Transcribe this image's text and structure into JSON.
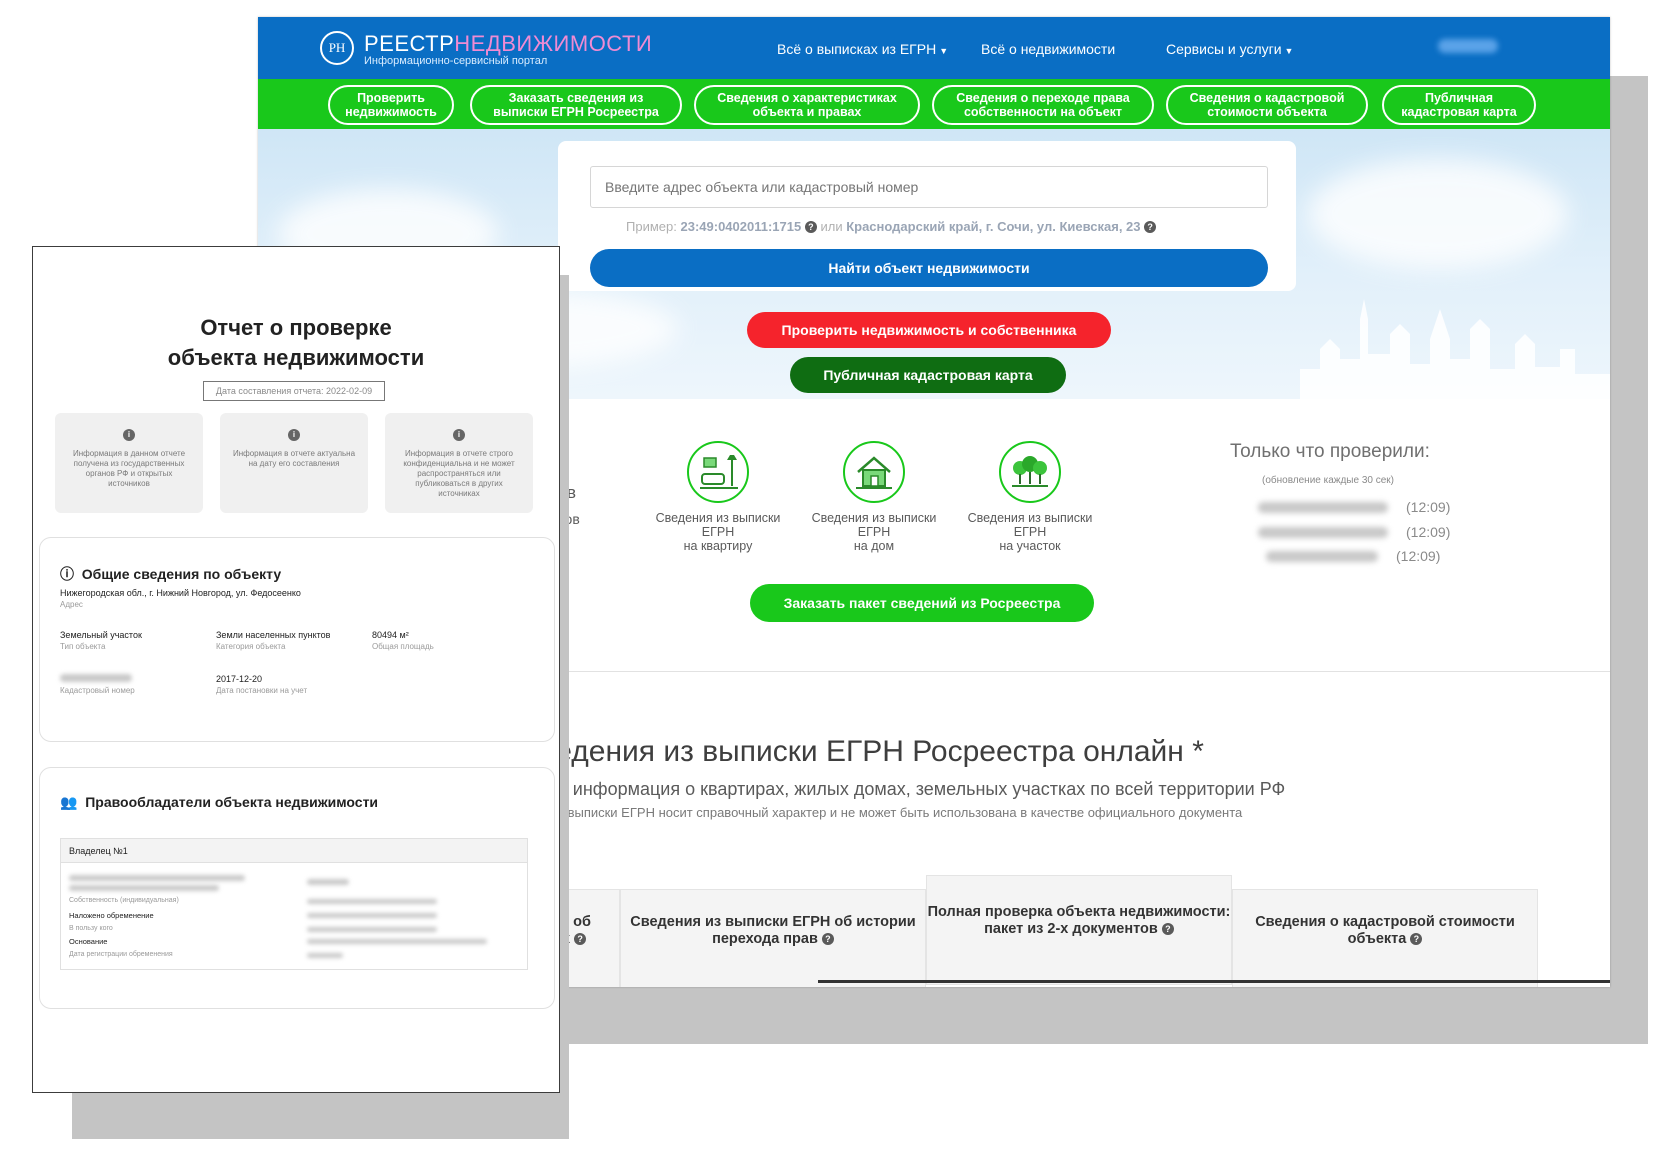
{
  "site": {
    "logo_mark": "РН",
    "logo_title_part1": "РЕЕСТР",
    "logo_title_part2": "НЕДВИЖИМОСТИ",
    "logo_subtitle": "Информационно-сервисный портал",
    "nav": [
      {
        "label": "Всё о выписках из ЕГРН",
        "dropdown": true
      },
      {
        "label": "Всё о недвижимости",
        "dropdown": false
      },
      {
        "label": "Сервисы и услуги",
        "dropdown": true
      }
    ],
    "green_nav": [
      "Проверить недвижимость",
      "Заказать сведения из выписки ЕГРН Росреестра",
      "Сведения о характеристиках объекта и правах",
      "Сведения о переходе права собственности на объект",
      "Сведения о кадастровой стоимости объекта",
      "Публичная кадастровая карта"
    ],
    "search": {
      "placeholder": "Введите адрес объекта или кадастровый номер",
      "example_prefix": "Пример:",
      "example_number": "23:49:0402011:1715",
      "example_or": "или",
      "example_address": "Краснодарский край, г. Сочи, ул. Киевская, 23"
    },
    "buttons": {
      "find": "Найти объект недвижимости",
      "check": "Проверить недвижимость и собственника",
      "map": "Публичная кадастровая карта",
      "order": "Заказать пакет сведений из Росреестра"
    },
    "services": [
      {
        "line1": "Сведения из выписки",
        "line2": "ЕГРН",
        "line3": "на квартиру",
        "icon": "apartment-icon"
      },
      {
        "line1": "Сведения из выписки",
        "line2": "ЕГРН",
        "line3": "на дом",
        "icon": "house-icon"
      },
      {
        "line1": "Сведения из выписки",
        "line2": "ЕГРН",
        "line3": "на участок",
        "icon": "land-plot-icon"
      }
    ],
    "partial_left": [
      "росов",
      "заказов"
    ],
    "recent": {
      "title": "Только что проверили:",
      "note": "(обновление каждые 30 сек)",
      "times": [
        "(12:09)",
        "(12:09)",
        "(12:09)"
      ]
    },
    "section": {
      "title": "Сведения из выписки ЕГРН Росреестра онлайн *",
      "subtitle": "ая информация о квартирах, жилых домах, земельных участках по всей территории РФ",
      "note": "з выписки ЕГРН носит справочный характер и не может быть использована в качестве официального документа"
    },
    "columns": {
      "partial_line1": "РН об",
      "partial_line2": "ах",
      "col2": "Сведения из выписки ЕГРН об истории перехода прав",
      "col3": "Полная проверка объекта недвижимости: пакет из 2-х документов",
      "col4": "Сведения о кадастровой стоимости объекта"
    },
    "colors": {
      "blue": "#0a6ec4",
      "green": "#19c81b",
      "red": "#f5232c",
      "dark_green": "#0f6d12",
      "accent_pink": "#f08bd3"
    }
  },
  "report": {
    "title_line1": "Отчет о проверке",
    "title_line2": "объекта недвижимости",
    "date_label": "Дата составления отчета: 2022-02-09",
    "info": [
      "Информация в данном отчете получена из государственных органов РФ и открытых источников",
      "Информация в отчете актуальна на дату его составления",
      "Информация в отчете строго конфиденциальна и не может распространяться или публиковаться в других источниках"
    ],
    "general": {
      "title": "Общие сведения по объекту",
      "address_value": "Нижегородская обл., г. Нижний Новгород, ул. Федосеенко",
      "address_label": "Адрес",
      "type_value": "Земельный участок",
      "type_label": "Тип объекта",
      "category_value": "Земли населенных пунктов",
      "category_label": "Категория объекта",
      "area_value": "80494 м²",
      "area_label": "Общая площадь",
      "cadastral_label": "Кадастровый номер",
      "reg_date_value": "2017-12-20",
      "reg_date_label": "Дата постановки на учет"
    },
    "owners": {
      "title": "Правообладатели объекта недвижимости",
      "owner_header": "Владелец №1",
      "ownership_label": "Собственность (индивидуальная)",
      "encumbrance_label": "Наложено обременение",
      "in_favor_label": "В пользу кого",
      "basis_label": "Основание",
      "encumbrance_date_label": "Дата регистрации обременения"
    }
  }
}
